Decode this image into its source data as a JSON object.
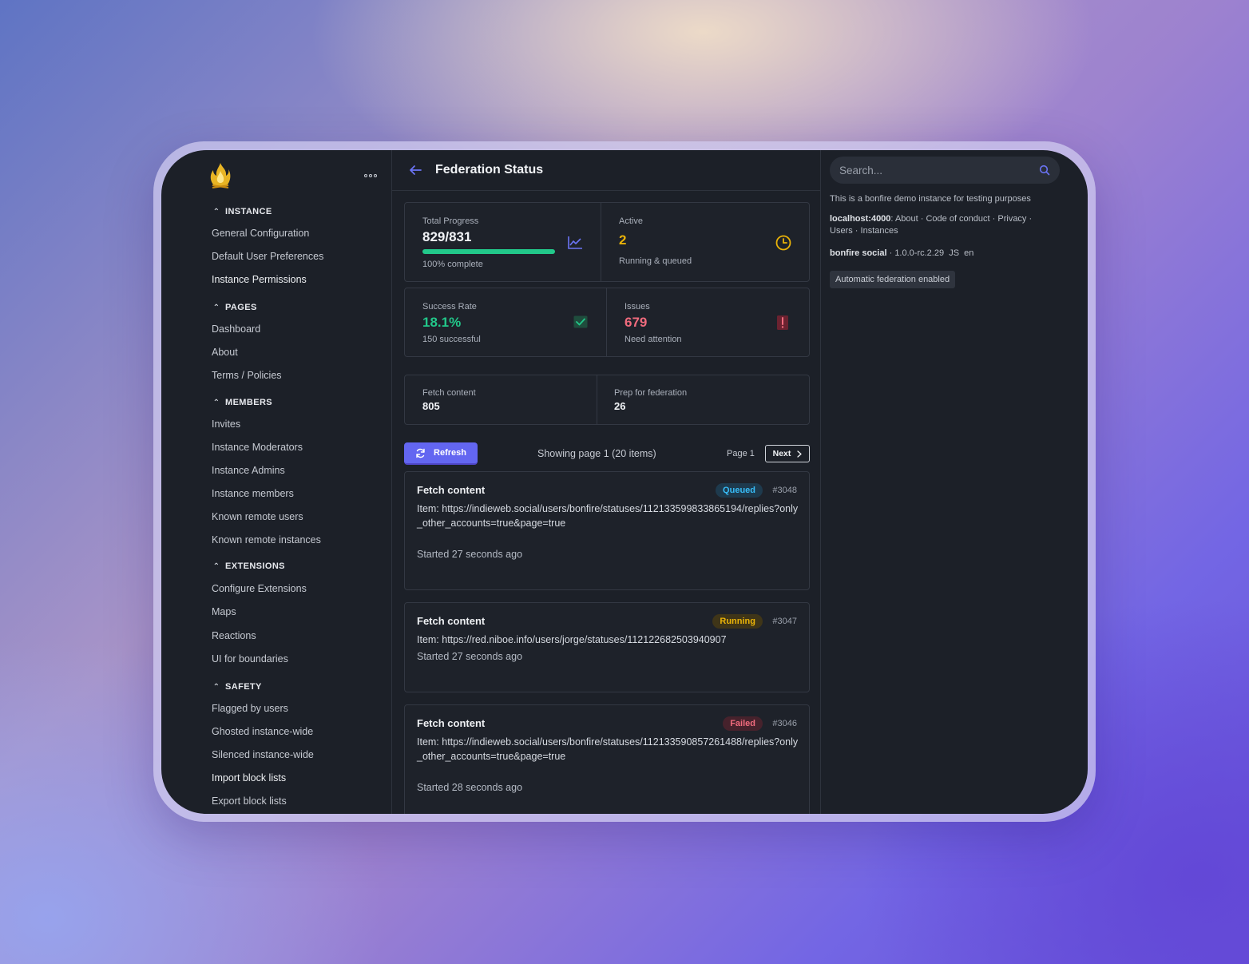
{
  "sidebar": {
    "sections": [
      {
        "title": "INSTANCE",
        "items": [
          "General Configuration",
          "Default User Preferences",
          "Instance Permissions"
        ]
      },
      {
        "title": "PAGES",
        "items": [
          "Dashboard",
          "About",
          "Terms / Policies"
        ]
      },
      {
        "title": "MEMBERS",
        "items": [
          "Invites",
          "Instance Moderators",
          "Instance Admins",
          "Instance members",
          "Known remote users",
          "Known remote instances"
        ]
      },
      {
        "title": "EXTENSIONS",
        "items": [
          "Configure Extensions",
          "Maps",
          "Reactions",
          "UI for boundaries"
        ]
      },
      {
        "title": "SAFETY",
        "items": [
          "Flagged by users",
          "Ghosted instance-wide",
          "Silenced instance-wide",
          "Import block lists",
          "Export block lists"
        ]
      }
    ]
  },
  "header": {
    "title": "Federation Status"
  },
  "stats": {
    "total_progress": {
      "label": "Total Progress",
      "value": "829/831",
      "sub": "100% complete",
      "progress": 0.998
    },
    "active": {
      "label": "Active",
      "value": "2",
      "sub": "Running & queued"
    },
    "success_rate": {
      "label": "Success Rate",
      "value": "18.1%",
      "sub": "150 successful"
    },
    "issues": {
      "label": "Issues",
      "value": "679",
      "sub": "Need attention"
    },
    "fetch_content": {
      "label": "Fetch content",
      "value": "805"
    },
    "prep_federation": {
      "label": "Prep for federation",
      "value": "26"
    }
  },
  "toolbar": {
    "refresh_label": "Refresh",
    "showing": "Showing page 1 (20 items)",
    "page_label": "Page 1",
    "next_label": "Next"
  },
  "jobs": [
    {
      "title": "Fetch content",
      "status": "Queued",
      "id": "#3048",
      "item": "Item: https://indieweb.social/users/bonfire/statuses/112133599833865194/replies?only_other_accounts=true&page=true",
      "started": "Started 27 seconds ago"
    },
    {
      "title": "Fetch content",
      "status": "Running",
      "id": "#3047",
      "item": "Item: https://red.niboe.info/users/jorge/statuses/112122682503940907",
      "started": "Started 27 seconds ago"
    },
    {
      "title": "Fetch content",
      "status": "Failed",
      "id": "#3046",
      "item": "Item: https://indieweb.social/users/bonfire/statuses/112133590857261488/replies?only_other_accounts=true&page=true",
      "started": "Started 28 seconds ago"
    }
  ],
  "right_panel": {
    "search_placeholder": "Search...",
    "description": "This is a bonfire demo instance for testing purposes",
    "host": "localhost:4000",
    "links": {
      "about": "About",
      "code_of_conduct": "Code of conduct",
      "privacy": "Privacy",
      "users": "Users",
      "instances": "Instances"
    },
    "app_name": "bonfire social",
    "version": "1.0.0-rc.2.29",
    "js_label": "JS",
    "locale": "en",
    "federation_tag": "Automatic federation enabled"
  },
  "colors": {
    "accent": "#6366f1",
    "success": "#22c88a",
    "warning": "#eab308",
    "danger": "#f06b7d",
    "queued": "#38bdf8"
  },
  "icons": [
    "bonfire-logo",
    "more-icon",
    "chevron-up-icon",
    "back-arrow-icon",
    "chart-line-icon",
    "clock-icon",
    "check-icon",
    "alert-icon",
    "refresh-icon",
    "chevron-right-icon",
    "search-icon"
  ]
}
